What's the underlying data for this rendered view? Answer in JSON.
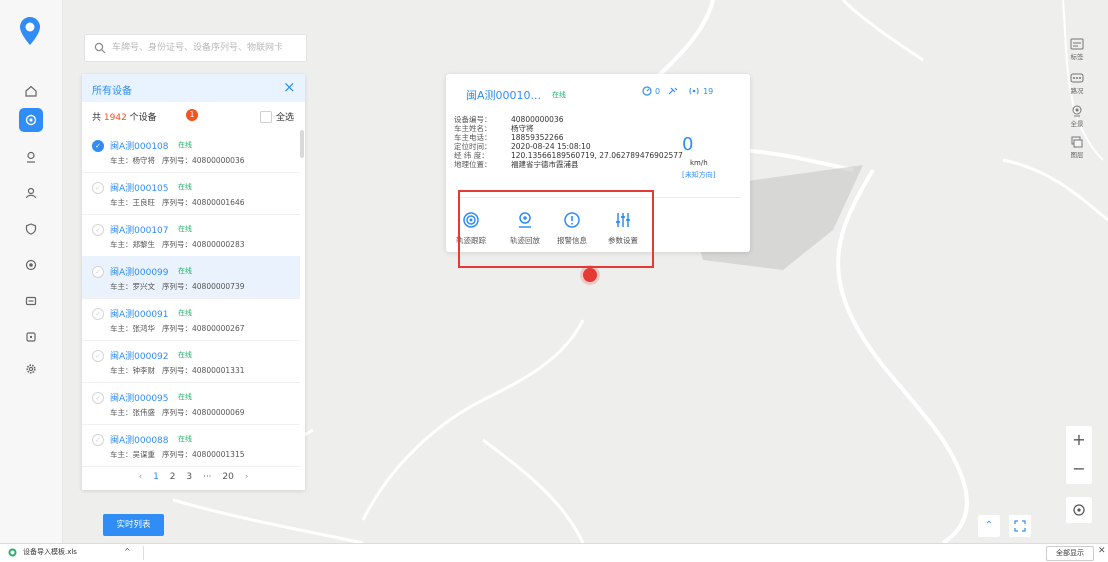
{
  "search": {
    "placeholder": "车牌号、身份证号、设备序列号、物联网卡"
  },
  "panel": {
    "title": "所有设备",
    "count_prefix": "共",
    "count": "1942",
    "count_suffix": "个设备",
    "badge": "1",
    "select_all": "全选",
    "devices": [
      {
        "plate": "闽A测000108",
        "status": "在线",
        "owner_label": "车主：",
        "owner": "杨守将",
        "serial_label": "序列号：",
        "serial": "40800000036",
        "checked": true,
        "selected": false
      },
      {
        "plate": "闽A测000105",
        "status": "在线",
        "owner_label": "车主：",
        "owner": "王良旺",
        "serial_label": "序列号：",
        "serial": "40800001646",
        "checked": false,
        "selected": false
      },
      {
        "plate": "闽A测000107",
        "status": "在线",
        "owner_label": "车主：",
        "owner": "郑黎生",
        "serial_label": "序列号：",
        "serial": "40800000283",
        "checked": false,
        "selected": false
      },
      {
        "plate": "闽A测000099",
        "status": "在线",
        "owner_label": "车主：",
        "owner": "罗兴文",
        "serial_label": "序列号：",
        "serial": "40800000739",
        "checked": false,
        "selected": true
      },
      {
        "plate": "闽A测000091",
        "status": "在线",
        "owner_label": "车主：",
        "owner": "张鸿华",
        "serial_label": "序列号：",
        "serial": "40800000267",
        "checked": false,
        "selected": false
      },
      {
        "plate": "闽A测000092",
        "status": "在线",
        "owner_label": "车主：",
        "owner": "钟李财",
        "serial_label": "序列号：",
        "serial": "40800001331",
        "checked": false,
        "selected": false
      },
      {
        "plate": "闽A测000095",
        "status": "在线",
        "owner_label": "车主：",
        "owner": "张伟盛",
        "serial_label": "序列号：",
        "serial": "40800000069",
        "checked": false,
        "selected": false
      },
      {
        "plate": "闽A测000088",
        "status": "在线",
        "owner_label": "车主：",
        "owner": "吴谋重",
        "serial_label": "序列号：",
        "serial": "40800001315",
        "checked": false,
        "selected": false
      }
    ],
    "pager": {
      "prev": "‹",
      "pages": [
        "1",
        "2",
        "3"
      ],
      "ellipsis": "···",
      "last": "20",
      "next": "›"
    }
  },
  "realtime_button": "实时列表",
  "popup": {
    "plate": "闽A测00010...",
    "status": "在线",
    "stat1": "0",
    "stat2": "19",
    "info": [
      {
        "k": "设备编号：",
        "v": "40800000036"
      },
      {
        "k": "车主姓名：",
        "v": "杨守将"
      },
      {
        "k": "车主电话：",
        "v": "18859352266"
      },
      {
        "k": "定位时间：",
        "v": "2020-08-24 15:08:10"
      },
      {
        "k": "经  纬  度：",
        "v": "120.13566189560719, 27.062789476902577"
      },
      {
        "k": "地理位置：",
        "v": "福建省宁德市霞浦县"
      }
    ],
    "speed": "0",
    "speed_unit": "km/h",
    "direction": "[未知方向]",
    "actions": [
      "轨迹跟踪",
      "轨迹回放",
      "报警信息",
      "参数设置"
    ]
  },
  "right_tools": [
    "标签",
    "路况",
    "全景",
    "图层"
  ],
  "zoom": {
    "in": "+",
    "out": "−"
  },
  "download_bar": {
    "file": "设备导入模板.xls",
    "caret": "^",
    "show_all": "全部显示",
    "close": "✕"
  },
  "colors": {
    "accent": "#2f8df5",
    "online": "#21b36b",
    "alert": "#e53935",
    "badge": "#f5541f"
  }
}
